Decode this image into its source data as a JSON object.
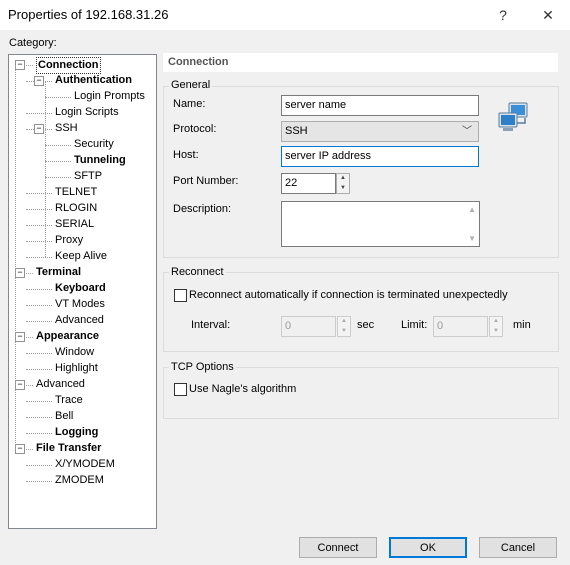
{
  "window": {
    "title": "Properties of 192.168.31.26",
    "help_glyph": "?",
    "close_glyph": "✕"
  },
  "category_label": "Category:",
  "tree": [
    {
      "label": "Connection",
      "level": 0,
      "bold": true,
      "expander": "−",
      "selected": true
    },
    {
      "label": "Authentication",
      "level": 1,
      "bold": true,
      "expander": "−"
    },
    {
      "label": "Login Prompts",
      "level": 2,
      "bold": false
    },
    {
      "label": "Login Scripts",
      "level": 1,
      "bold": false
    },
    {
      "label": "SSH",
      "level": 1,
      "bold": false,
      "expander": "−"
    },
    {
      "label": "Security",
      "level": 2,
      "bold": false
    },
    {
      "label": "Tunneling",
      "level": 2,
      "bold": true
    },
    {
      "label": "SFTP",
      "level": 2,
      "bold": false
    },
    {
      "label": "TELNET",
      "level": 1,
      "bold": false
    },
    {
      "label": "RLOGIN",
      "level": 1,
      "bold": false
    },
    {
      "label": "SERIAL",
      "level": 1,
      "bold": false
    },
    {
      "label": "Proxy",
      "level": 1,
      "bold": false
    },
    {
      "label": "Keep Alive",
      "level": 1,
      "bold": false
    },
    {
      "label": "Terminal",
      "level": 0,
      "bold": true,
      "expander": "−"
    },
    {
      "label": "Keyboard",
      "level": 1,
      "bold": true
    },
    {
      "label": "VT Modes",
      "level": 1,
      "bold": false
    },
    {
      "label": "Advanced",
      "level": 1,
      "bold": false
    },
    {
      "label": "Appearance",
      "level": 0,
      "bold": true,
      "expander": "−"
    },
    {
      "label": "Window",
      "level": 1,
      "bold": false
    },
    {
      "label": "Highlight",
      "level": 1,
      "bold": false
    },
    {
      "label": "Advanced",
      "level": 0,
      "bold": false,
      "expander": "−"
    },
    {
      "label": "Trace",
      "level": 1,
      "bold": false
    },
    {
      "label": "Bell",
      "level": 1,
      "bold": false
    },
    {
      "label": "Logging",
      "level": 1,
      "bold": true
    },
    {
      "label": "File Transfer",
      "level": 0,
      "bold": true,
      "expander": "−"
    },
    {
      "label": "X/YMODEM",
      "level": 1,
      "bold": false
    },
    {
      "label": "ZMODEM",
      "level": 1,
      "bold": false
    }
  ],
  "panel_header": "Connection",
  "general": {
    "group_label": "General",
    "name_label": "Name:",
    "name_value": "server name",
    "protocol_label": "Protocol:",
    "protocol_value": "SSH",
    "host_label": "Host:",
    "host_value": "server IP address",
    "port_label": "Port Number:",
    "port_value": "22",
    "description_label": "Description:",
    "description_value": ""
  },
  "reconnect": {
    "group_label": "Reconnect",
    "checkbox_label": "Reconnect automatically if connection is terminated unexpectedly",
    "checked": false,
    "interval_label": "Interval:",
    "interval_value": "0",
    "interval_unit": "sec",
    "limit_label": "Limit:",
    "limit_value": "0",
    "limit_unit": "min"
  },
  "tcp": {
    "group_label": "TCP Options",
    "nagle_label": "Use Nagle's algorithm",
    "checked": false
  },
  "buttons": {
    "connect": "Connect",
    "ok": "OK",
    "cancel": "Cancel"
  },
  "colors": {
    "accent": "#0078d7",
    "window_bg": "#f0f0f0"
  }
}
